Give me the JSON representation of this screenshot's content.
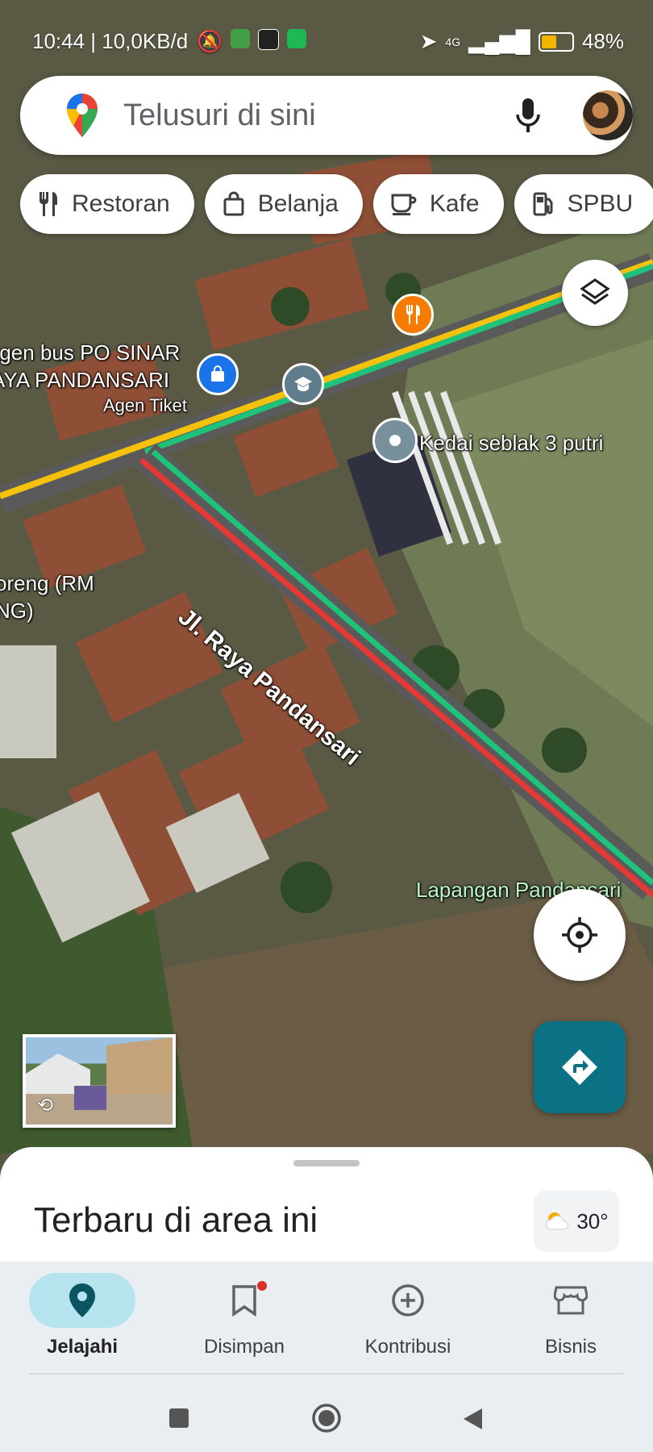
{
  "status_bar": {
    "time": "10:44 | 10,0KB/d",
    "network": "4G",
    "battery": "48%"
  },
  "search": {
    "placeholder": "Telusuri di sini"
  },
  "chips": [
    {
      "label": "Restoran",
      "icon": "restaurant-icon"
    },
    {
      "label": "Belanja",
      "icon": "shopping-bag-icon"
    },
    {
      "label": "Kafe",
      "icon": "cafe-icon"
    },
    {
      "label": "SPBU",
      "icon": "gas-station-icon"
    }
  ],
  "map": {
    "labels": {
      "agen_bus": "Agen bus PO SINAR",
      "agen_bus_2": "JAYA PANDANSARI",
      "agen_tiket": "Agen Tiket",
      "kedai": "Kedai seblak 3 putri",
      "street": "Jl. Raya Pandansari",
      "lapangan": "Lapangan Pandansari",
      "rm_line1": "oreng (RM",
      "rm_line2": "NG)"
    }
  },
  "sheet": {
    "title": "Terbaru di area ini",
    "temperature": "30°"
  },
  "bottom_nav": [
    {
      "label": "Jelajahi",
      "icon": "explore-pin-icon",
      "active": true
    },
    {
      "label": "Disimpan",
      "icon": "bookmark-icon",
      "active": false
    },
    {
      "label": "Kontribusi",
      "icon": "add-circle-icon",
      "active": false
    },
    {
      "label": "Bisnis",
      "icon": "store-icon",
      "active": false
    }
  ],
  "colors": {
    "accent": "#0b7285",
    "nav_active": "#b5e3ee",
    "route_green": "#1fc27a",
    "route_red": "#e53935",
    "route_yellow": "#f4c20d"
  }
}
